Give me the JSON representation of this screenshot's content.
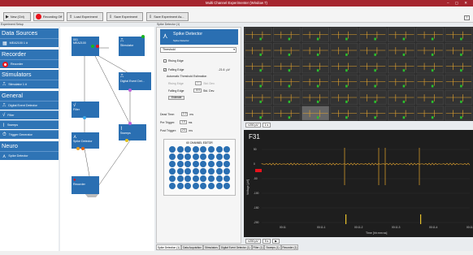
{
  "window": {
    "title": "Multi Channel Experimenter (Window 7)"
  },
  "toolbar": {
    "new_label": "New (Ctrl)",
    "recording_label": "Recording Off",
    "load_label": "Load Experiment",
    "save_label": "Save Experiment",
    "save_as_label": "Save Experiment As..."
  },
  "sidebar": {
    "title": "Experiment Setup",
    "sections": {
      "data_sources": "Data Sources",
      "recorder": "Recorder",
      "stimulators": "Stimulators",
      "general": "General",
      "neuro": "Neuro"
    },
    "items": {
      "mea": "MEA2100 1 #",
      "recorder": "Recorder",
      "stimulator": "Stimulator 1 #",
      "digital_event": "Digital Event Detector",
      "filter": "Filter",
      "sweeps": "Sweeps",
      "trigger": "Trigger Generator",
      "spike": "Spike Detector"
    }
  },
  "canvas": {
    "nodes": {
      "mea": "001\nMEA2100",
      "stimulator": "Stimulator",
      "digital": "Digital Event Det...",
      "filter": "Filter",
      "spike": "Spike Detector",
      "sweeps": "Sweeps",
      "recorder": "Recorder"
    }
  },
  "props": {
    "panel_title": "Spike Detector (1)",
    "title": "Spike Detector",
    "subtitle": "Spike Detector",
    "mode": "Threshold",
    "rising_edge": "Rising Edge",
    "falling_edge": "Falling Edge",
    "falling_value": "-21.6",
    "falling_unit": "µV",
    "auto_group": "Automatic Threshold Estimation",
    "rising_label": "Rising Edge",
    "rising_val": "5.0",
    "falling_label": "Falling Edge",
    "falling_val": "-5.0",
    "std_dev": "Std. Dev.",
    "estimate_btn": "Estimate",
    "dead_time_label": "Dead Time:",
    "dead_time": "1.0",
    "pre_trig_label": "Pre Trigger:",
    "pre_trig": "1.0",
    "post_trig_label": "Post Trigger:",
    "post_trig": "2.0",
    "unit_ms": "ms",
    "channel_title": "60 CHANNEL EDITOR"
  },
  "scope": {
    "channel": "F31",
    "ylabel": "Voltage [µV]",
    "xlabel": "Time [hh:mm:ss]",
    "range1": "±200 µV",
    "time1": "1 s",
    "range2": "±200 µV",
    "time2": "5 s",
    "yticks": [
      "50",
      "0",
      "-50",
      "-100",
      "-150",
      "-200"
    ],
    "xticks": [
      "00:11",
      "00:11.1",
      "00:11.2",
      "00:11.3",
      "00:11.4",
      "00:11.5"
    ]
  },
  "tabs": [
    "Spike Detection (1)",
    "Data Acquisition",
    "Stimulators",
    "Digital Event Detector (1)",
    "Filter (1)",
    "Sweeps (1)",
    "Recorder (1)"
  ],
  "colors": {
    "accent": "#a6262f",
    "blue": "#2a6fb2",
    "trace": "#e7a52c"
  }
}
